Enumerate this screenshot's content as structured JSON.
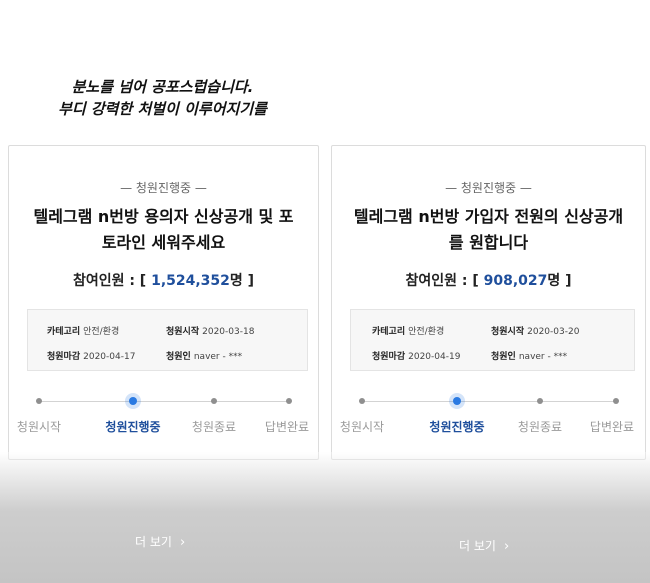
{
  "caption": {
    "line1": "분노를 넘어 공포스럽습니다.",
    "line2": "부디 강력한 처벌이 이루어지기를"
  },
  "cards": [
    {
      "status": "— 청원진행중 —",
      "title": "텔레그램 n번방 용의자 신상공개 및 포토라인 세워주세요",
      "participants_label": "참여인원 : [ ",
      "participants_value": "1,524,352",
      "participants_suffix": "명 ]",
      "info": {
        "category_label": "카테고리",
        "category_value": "안전/환경",
        "start_label": "청원시작",
        "start_value": "2020-03-18",
        "deadline_label": "청원마감",
        "deadline_value": "2020-04-17",
        "author_label": "청원인",
        "author_value": "naver - ***"
      },
      "steps": [
        "청원시작",
        "청원진행중",
        "청원종료",
        "답변완료"
      ],
      "more_label": "더 보기"
    },
    {
      "status": "— 청원진행중 —",
      "title": "텔레그램 n번방 가입자 전원의 신상공개를 원합니다",
      "participants_label": "참여인원 : [ ",
      "participants_value": "908,027",
      "participants_suffix": "명 ]",
      "info": {
        "category_label": "카테고리",
        "category_value": "안전/환경",
        "start_label": "청원시작",
        "start_value": "2020-03-20",
        "deadline_label": "청원마감",
        "deadline_value": "2020-04-19",
        "author_label": "청원인",
        "author_value": "naver - ***"
      },
      "steps": [
        "청원시작",
        "청원진행중",
        "청원종료",
        "답변완료"
      ],
      "more_label": "더 보기"
    }
  ],
  "active_step": "청원진행중",
  "colors": {
    "accent_blue": "#1f4f9c",
    "active_dot": "#2a7ae2"
  }
}
